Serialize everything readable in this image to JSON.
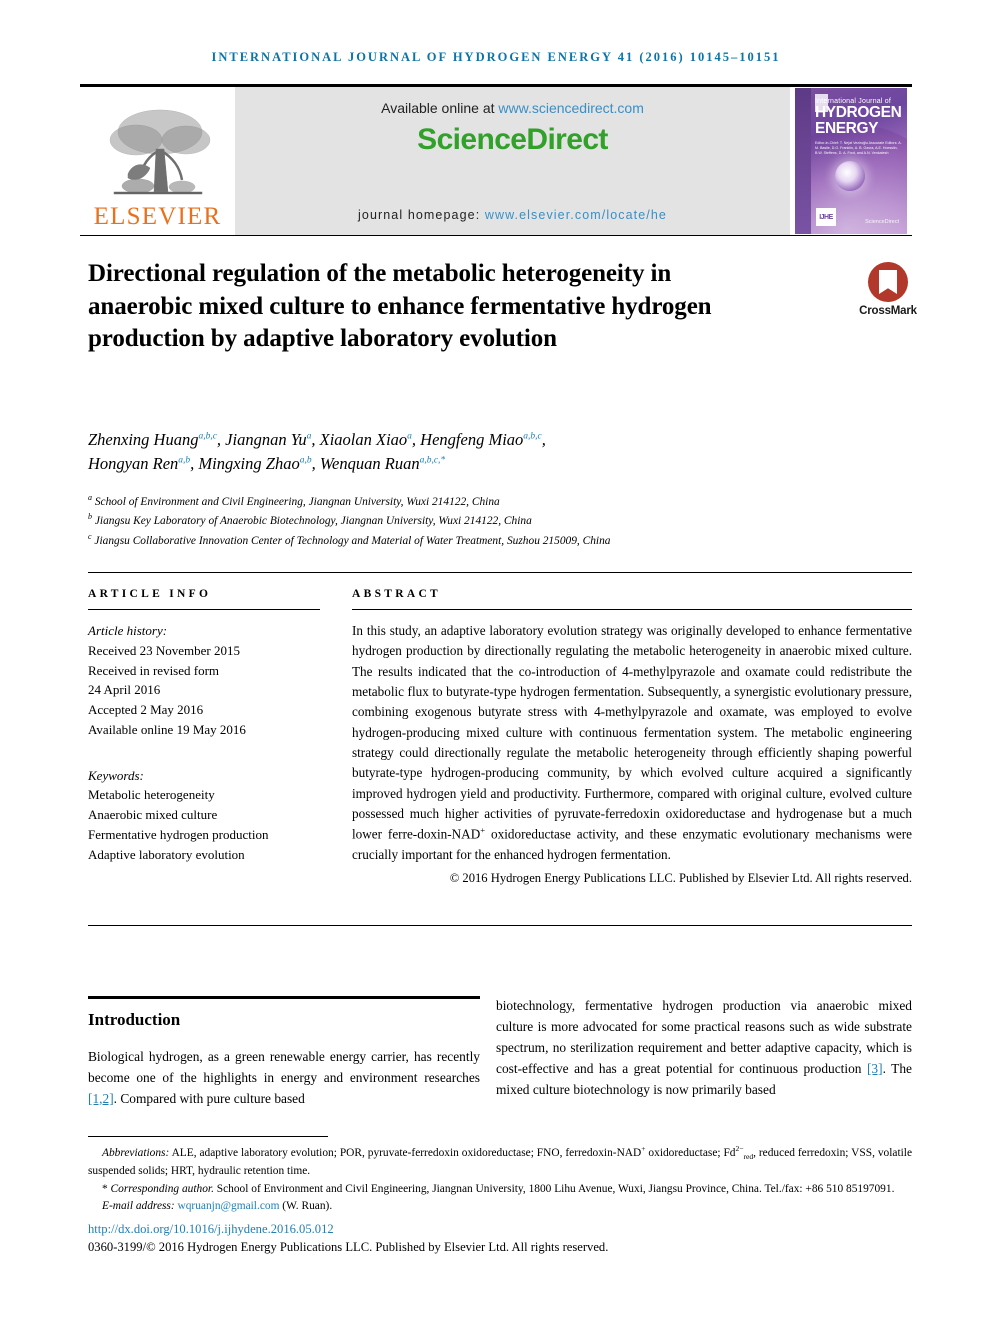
{
  "running_head": "International Journal of Hydrogen Energy 41 (2016) 10145–10151",
  "masthead": {
    "elsevier_wordmark": "ELSEVIER",
    "available_prefix": "Available online at ",
    "available_url": "www.sciencedirect.com",
    "sciencedirect_logo": "ScienceDirect",
    "homepage_prefix": "journal homepage: ",
    "homepage_url": "www.elsevier.com/locate/he",
    "cover": {
      "line1": "International Journal of",
      "line2": "HYDROGEN",
      "line3": "ENERGY",
      "editors": "Editor-in-Chief: T. Nejat Veziroğlu   Associate Editors: A. M. Basile, D.G. Franklin, A. B. Gavra, A.E. Hoesslin, B.W. Steffens, D. A. Ford, and A.N. Venkatesh",
      "badge": "IJHE",
      "sciencedirect_mark": "ScienceDirect"
    }
  },
  "title": "Directional regulation of the metabolic heterogeneity in anaerobic mixed culture to enhance fermentative hydrogen production by adaptive laboratory evolution",
  "crossmark": {
    "label": "CrossMark",
    "icon": "crossmark-icon",
    "color": "#b1382b"
  },
  "authors": [
    {
      "name": "Zhenxing Huang",
      "sup": "a,b,c",
      "sep": ", "
    },
    {
      "name": "Jiangnan Yu",
      "sup": "a",
      "sep": ", "
    },
    {
      "name": "Xiaolan Xiao",
      "sup": "a",
      "sep": ", "
    },
    {
      "name": "Hengfeng Miao",
      "sup": "a,b,c",
      "sep": ", "
    },
    {
      "name": "Hongyan Ren",
      "sup": "a,b",
      "sep": ", "
    },
    {
      "name": "Mingxing Zhao",
      "sup": "a,b",
      "sep": ", "
    },
    {
      "name": "Wenquan Ruan",
      "sup": "a,b,c,*",
      "sep": ""
    }
  ],
  "affiliations": [
    {
      "marker": "a",
      "text": "School of Environment and Civil Engineering, Jiangnan University, Wuxi 214122, China"
    },
    {
      "marker": "b",
      "text": "Jiangsu Key Laboratory of Anaerobic Biotechnology, Jiangnan University, Wuxi 214122, China"
    },
    {
      "marker": "c",
      "text": "Jiangsu Collaborative Innovation Center of Technology and Material of Water Treatment, Suzhou 215009, China"
    }
  ],
  "article_info": {
    "heading": "ARTICLE INFO",
    "history_label": "Article history:",
    "history": [
      "Received 23 November 2015",
      "Received in revised form",
      "24 April 2016",
      "Accepted 2 May 2016",
      "Available online 19 May 2016"
    ],
    "keywords_label": "Keywords:",
    "keywords": [
      "Metabolic heterogeneity",
      "Anaerobic mixed culture",
      "Fermentative hydrogen production",
      "Adaptive laboratory evolution"
    ]
  },
  "abstract": {
    "heading": "ABSTRACT",
    "part1": "In this study, an adaptive laboratory evolution strategy was originally developed to enhance fermentative hydrogen production by directionally regulating the metabolic heterogeneity in anaerobic mixed culture. The results indicated that the co-introduction of 4-methylpyrazole and oxamate could redistribute the metabolic flux to butyrate-type hydrogen fermentation. Subsequently, a synergistic evolutionary pressure, combining exogenous butyrate stress with 4-methylpyrazole and oxamate, was employed to evolve hydrogen-producing mixed culture with continuous fermentation system. The metabolic engineering strategy could directionally regulate the metabolic heterogeneity through efficiently shaping powerful butyrate-type hydrogen-producing community, by which evolved culture acquired a significantly improved hydrogen yield and productivity. Furthermore, compared with original culture, evolved culture possessed much higher activities of pyruvate-ferredoxin oxidoreductase and hydrogenase but a much lower ferre-",
    "part2_pre": "doxin-NAD",
    "part2_sup": "+",
    "part2_post": " oxidoreductase activity, and these enzymatic evolutionary mechanisms were crucially important for the enhanced hydrogen fermentation.",
    "copyright": "© 2016 Hydrogen Energy Publications LLC. Published by Elsevier Ltd. All rights reserved."
  },
  "body": {
    "intro_heading": "Introduction",
    "left_pre": "Biological hydrogen, as a green renewable energy carrier, has recently become one of the highlights in energy and environment researches ",
    "left_ref": "[1,2]",
    "left_post": ". Compared with pure culture based",
    "right_pre": "biotechnology, fermentative hydrogen production via anaerobic mixed culture is more advocated for some practical reasons such as wide substrate spectrum, no sterilization requirement and better adaptive capacity, which is cost-effective and has a great potential for continuous production ",
    "right_ref": "[3]",
    "right_post": ". The mixed culture biotechnology is now primarily based"
  },
  "footnotes": {
    "abbrev_label": "Abbreviations:",
    "abbrev_text_1": " ALE, adaptive laboratory evolution; POR, pyruvate-ferredoxin oxidoreductase; FNO, ferredoxin-NAD",
    "abbrev_sup_1": "+",
    "abbrev_text_2": " oxidoreductase; Fd",
    "abbrev_sup_2": "2−",
    "abbrev_sub_2": "red",
    "abbrev_text_3": ", reduced ferredoxin; VSS, volatile suspended solids; HRT, hydraulic retention time.",
    "corr_marker": "*",
    "corr_label": " Corresponding author.",
    "corr_text": " School of Environment and Civil Engineering, Jiangnan University, 1800 Lihu Avenue, Wuxi, Jiangsu Province, China. Tel./fax: +86 510 85197091.",
    "email_label": "E-mail address: ",
    "email_value": "wqruanjn@gmail.com",
    "email_owner": " (W. Ruan).",
    "doi": "http://dx.doi.org/10.1016/j.ijhydene.2016.05.012",
    "issn_line": "0360-3199/© 2016 Hydrogen Energy Publications LLC. Published by Elsevier Ltd. All rights reserved."
  }
}
